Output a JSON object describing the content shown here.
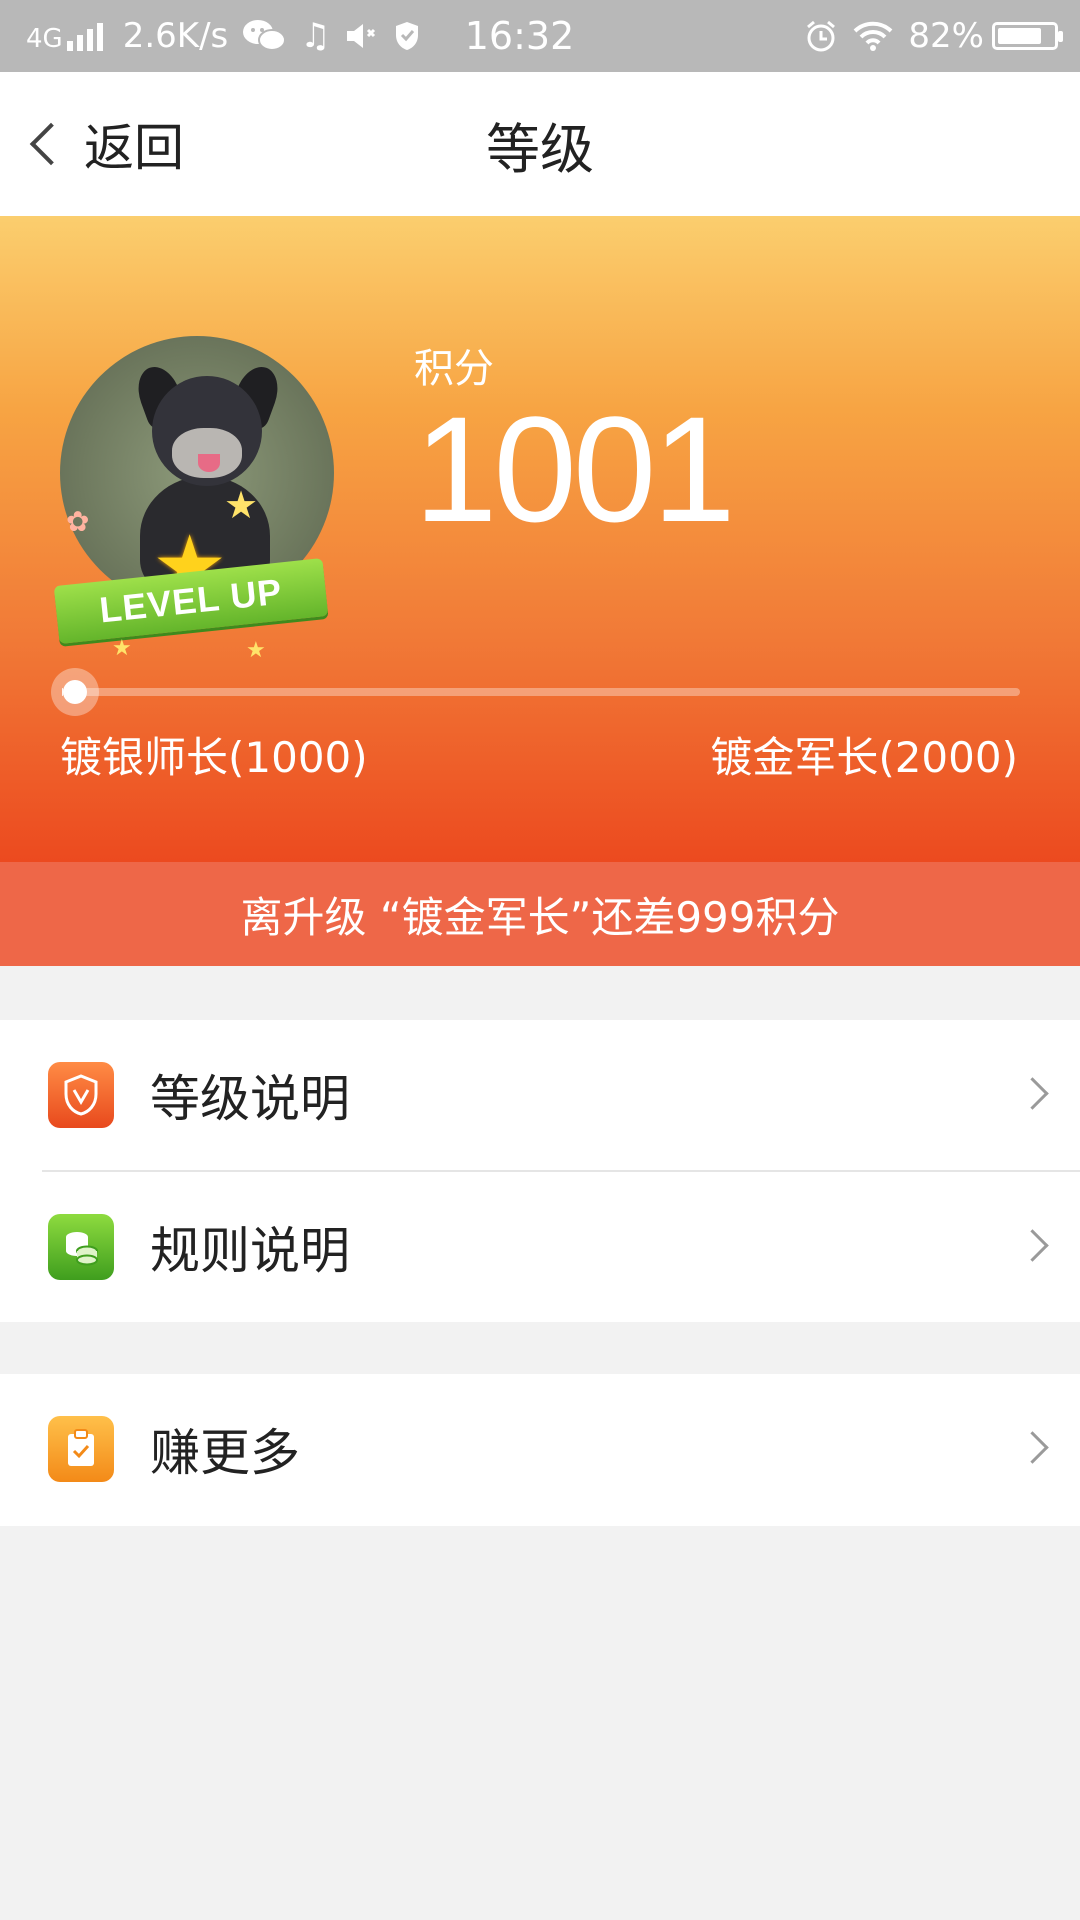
{
  "status_bar": {
    "network": "4G",
    "speed": "2.6K/s",
    "time": "16:32",
    "battery": "82%",
    "battery_level": 0.82
  },
  "header": {
    "back_label": "返回",
    "title": "等级"
  },
  "profile": {
    "badge_text": "LEVEL UP",
    "score_label": "积分",
    "score_value": "1001"
  },
  "progress": {
    "current_level": "镀银师长(1000)",
    "next_level": "镀金军长(2000)",
    "min": 1000,
    "max": 2000,
    "value": 1001,
    "fraction": 0.001
  },
  "hint": "离升级 “镀金军长”还差999积分",
  "menu": {
    "items": [
      {
        "label": "等级说明",
        "icon": "shield-icon"
      },
      {
        "label": "规则说明",
        "icon": "coins-icon"
      },
      {
        "label": "赚更多",
        "icon": "clipboard-check-icon"
      }
    ]
  },
  "colors": {
    "hero_top": "#fbce6e",
    "hero_bottom": "#ec4a1f",
    "hint_bar": "#ee6748",
    "page_bg": "#f2f2f2"
  }
}
